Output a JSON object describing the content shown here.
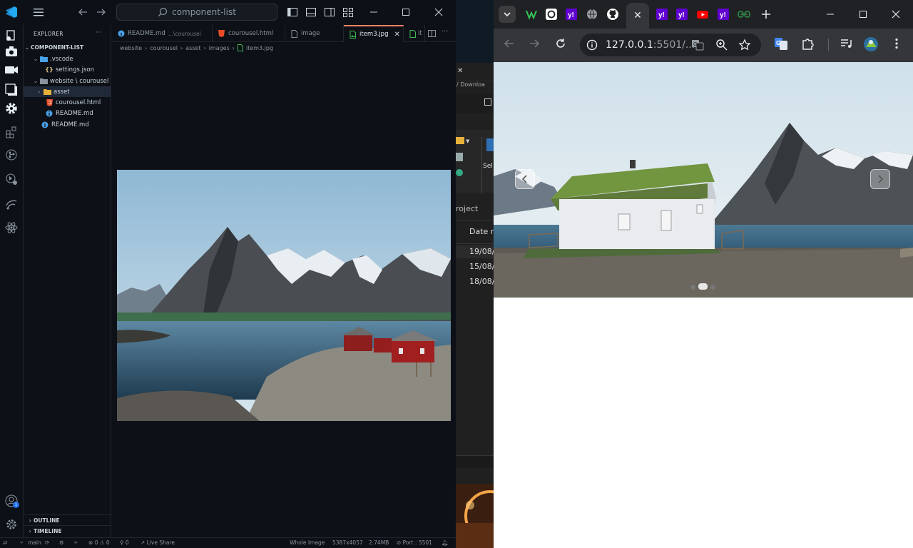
{
  "vscode": {
    "search": "component-list",
    "sidebar": {
      "title": "EXPLORER",
      "project": "COMPONENT-LIST",
      "tree": [
        {
          "label": ".vscode",
          "type": "folder",
          "depth": 1
        },
        {
          "label": "settings.json",
          "type": "json",
          "depth": 2
        },
        {
          "label": "website \\ courousel",
          "type": "folder",
          "depth": 1
        },
        {
          "label": "asset",
          "type": "folder-closed",
          "depth": 2
        },
        {
          "label": "courousel.html",
          "type": "html",
          "depth": 2
        },
        {
          "label": "README.md",
          "type": "info",
          "depth": 2
        },
        {
          "label": "README.md",
          "type": "info",
          "depth": 1
        }
      ],
      "outline": "OUTLINE",
      "timeline": "TIMELINE"
    },
    "tabs": [
      {
        "label": "README.md",
        "desc": "...\\courousel",
        "icon": "info-icon"
      },
      {
        "label": "courousel.html",
        "desc": "",
        "icon": "html-icon"
      },
      {
        "label": "image",
        "desc": "",
        "icon": "file-icon"
      },
      {
        "label": "item3.jpg",
        "desc": "",
        "icon": "image-icon",
        "active": true
      },
      {
        "label": "it",
        "desc": "",
        "icon": "image-icon"
      }
    ],
    "breadcrumb": [
      "website",
      "courousel",
      "asset",
      "images",
      "item3.jpg"
    ],
    "status": {
      "branch": "main",
      "problems": "0 ⚠ 0",
      "ports": "0",
      "live_share": "Live Share",
      "zoom": "Whole Image",
      "dimensions": "5387x4057",
      "size": "2.74MB",
      "port": "Port : 5501"
    },
    "account_badge": "1"
  },
  "middle": {
    "path": "Downloa",
    "sel": "Sel",
    "project": "roject",
    "date_header": "Date m",
    "dates": [
      "19/08/",
      "15/08/",
      "18/08/"
    ]
  },
  "chrome": {
    "url_host": "127.0.0.1",
    "url_rest": ":5501/...",
    "colors": {
      "tabbar": "#202124",
      "toolbar": "#35363a",
      "yahoo": "#6001d2",
      "youtube": "#ff0000"
    }
  }
}
